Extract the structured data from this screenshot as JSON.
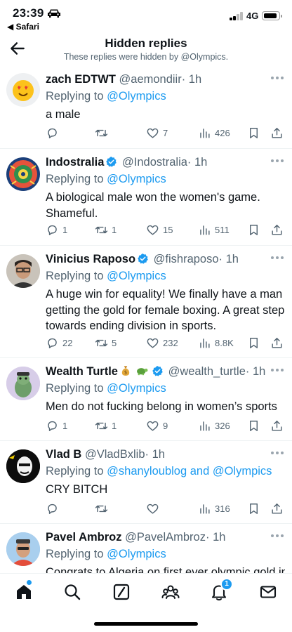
{
  "status_bar": {
    "time": "23:39",
    "back_app": "◀ Safari",
    "network": "4G"
  },
  "header": {
    "title": "Hidden replies",
    "subtitle": "These replies were hidden by @Olympics."
  },
  "tweets": [
    {
      "name": "zach EDTWT",
      "handle": "@aemondiir",
      "time": "· 1h",
      "reply_prefix": "Replying to ",
      "reply_to": "@Olympics",
      "text": "a male",
      "replies": "",
      "retweets": "",
      "likes": "7",
      "views": "426"
    },
    {
      "name": "Indostralia",
      "handle": "@Indostralia",
      "time": "· 1h",
      "reply_prefix": "Replying to ",
      "reply_to": "@Olympics",
      "text": "A biological male won the women's game. Shameful.",
      "replies": "1",
      "retweets": "1",
      "likes": "15",
      "views": "511"
    },
    {
      "name": "Vinicius Raposo",
      "handle": "@fishraposo",
      "time": "· 1h",
      "reply_prefix": "Replying to ",
      "reply_to": "@Olympics",
      "text": "A huge win for equality! We finally have a man getting the gold for female boxing. A great step towards ending division in sports.",
      "replies": "22",
      "retweets": "5",
      "likes": "232",
      "views": "8.8K"
    },
    {
      "name": "Wealth Turtle",
      "handle": "@wealth_turtle",
      "time": "· 1h",
      "reply_prefix": "Replying to ",
      "reply_to": "@Olympics",
      "text": "Men do not fucking belong in women’s sports",
      "replies": "1",
      "retweets": "1",
      "likes": "9",
      "views": "326"
    },
    {
      "name": "Vlad B",
      "handle": "@VladBxlib",
      "time": "· 1h",
      "reply_prefix": "Replying to ",
      "reply_to": "@shanyloublog and @Olympics",
      "text": "CRY BITCH",
      "replies": "",
      "retweets": "",
      "likes": "",
      "views": "316"
    },
    {
      "name": "Pavel Ambroz",
      "handle": "@PavelAmbroz",
      "time": "· 1h",
      "reply_prefix": "Replying to ",
      "reply_to": "@Olympics",
      "text": "Congrats to Algeria on first ever olympic gold in",
      "replies": "",
      "retweets": "",
      "likes": "",
      "views": ""
    }
  ],
  "tabbar": {
    "notification_count": "1"
  },
  "icons": [
    "car-icon",
    "back-arrow-icon",
    "verified-badge-icon",
    "more-icon",
    "reply-icon",
    "retweet-icon",
    "like-icon",
    "views-icon",
    "bookmark-icon",
    "share-icon",
    "home-icon",
    "search-icon",
    "grok-icon",
    "communities-icon",
    "notifications-icon",
    "messages-icon"
  ],
  "colors": {
    "accent": "#1d9bf0",
    "text": "#0f1419",
    "secondary": "#536471"
  }
}
